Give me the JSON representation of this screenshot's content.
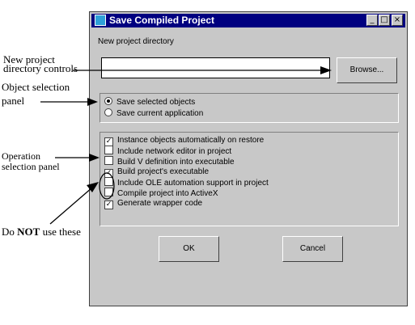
{
  "window": {
    "title": "Save Compiled Project",
    "minimize_glyph": "_",
    "maximize_glyph": "□",
    "close_glyph": "×"
  },
  "directory": {
    "label": "New project directory",
    "value": "",
    "browse_label": "Browse..."
  },
  "object_panel": {
    "options": [
      {
        "label": "Save selected objects",
        "selected": true
      },
      {
        "label": "Save current application",
        "selected": false
      }
    ]
  },
  "operation_panel": {
    "options": [
      {
        "label": "Instance objects automatically on restore",
        "checked": true
      },
      {
        "label": "Include network editor in project",
        "checked": false
      },
      {
        "label": "Build V definition into executable",
        "checked": false
      },
      {
        "label": "Build project's executable",
        "checked": true
      },
      {
        "label": "Include OLE automation support in project",
        "checked": false
      },
      {
        "label": "Compile project into ActiveX",
        "checked": false
      },
      {
        "label": "Generate wrapper code",
        "checked": true
      }
    ]
  },
  "buttons": {
    "ok_label": "OK",
    "cancel_label": "Cancel"
  },
  "annotations": {
    "dir_controls_line1": "New project",
    "dir_controls_line2": "directory controls",
    "object_panel_line1": "Object selection",
    "object_panel_line2": "panel",
    "operation_panel_line1": "Operation",
    "operation_panel_line2": "selection panel",
    "do_not_prefix": "Do",
    "do_not_emphasis": "NOT",
    "do_not_suffix": "use these"
  }
}
